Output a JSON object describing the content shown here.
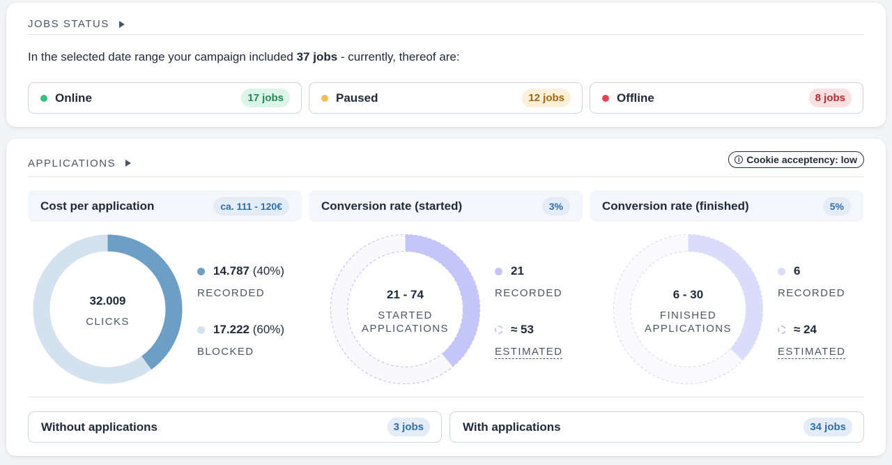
{
  "jobs_status": {
    "title": "JOBS STATUS",
    "intro_prefix": "In the selected date range your campaign included ",
    "intro_bold": "37 jobs",
    "intro_suffix": " - currently, thereof are:",
    "items": [
      {
        "label": "Online",
        "count": "17 jobs",
        "dot": "#34c17b",
        "pill_bg": "#dcf5e8",
        "pill_fg": "#1f8a55"
      },
      {
        "label": "Paused",
        "count": "12 jobs",
        "dot": "#f5bd58",
        "pill_bg": "#fdf0d8",
        "pill_fg": "#a1650d"
      },
      {
        "label": "Offline",
        "count": "8 jobs",
        "dot": "#e0484e",
        "pill_bg": "#fbe0e1",
        "pill_fg": "#b32a31"
      }
    ]
  },
  "applications": {
    "title": "APPLICATIONS",
    "cookie_label": "Cookie acceptency: low",
    "metrics": [
      {
        "label": "Cost per application",
        "value": "ca. 111 - 120€"
      },
      {
        "label": "Conversion rate (started)",
        "value": "3%"
      },
      {
        "label": "Conversion rate (finished)",
        "value": "5%"
      }
    ],
    "clicks": {
      "center_value": "32.009",
      "center_label": "CLICKS",
      "recorded_value": "14.787",
      "recorded_pct": "(40%)",
      "recorded_label": "RECORDED",
      "blocked_value": "17.222",
      "blocked_pct": "(60%)",
      "blocked_label": "BLOCKED",
      "recorded_fraction": 0.4,
      "recorded_color": "#6d9ec6",
      "blocked_color": "#d3e2ee"
    },
    "started": {
      "center_value": "21 - 74",
      "center_label_1": "STARTED",
      "center_label_2": "APPLICATIONS",
      "recorded_value": "21",
      "recorded_label": "RECORDED",
      "estimated_value": "≈ 53",
      "estimated_label": "ESTIMATED",
      "recorded_fraction": 0.39,
      "color": "#c4c6fa",
      "dash_color": "#cbc0f2"
    },
    "finished": {
      "center_value": "6 - 30",
      "center_label_1": "FINISHED",
      "center_label_2": "APPLICATIONS",
      "recorded_value": "6",
      "recorded_label": "RECORDED",
      "estimated_value": "≈ 24",
      "estimated_label": "ESTIMATED",
      "recorded_fraction": 0.37,
      "color": "#dadcfc",
      "dash_color": "#dcdcf0"
    },
    "bottom": [
      {
        "label": "Without applications",
        "count": "3 jobs"
      },
      {
        "label": "With applications",
        "count": "34 jobs"
      }
    ]
  }
}
